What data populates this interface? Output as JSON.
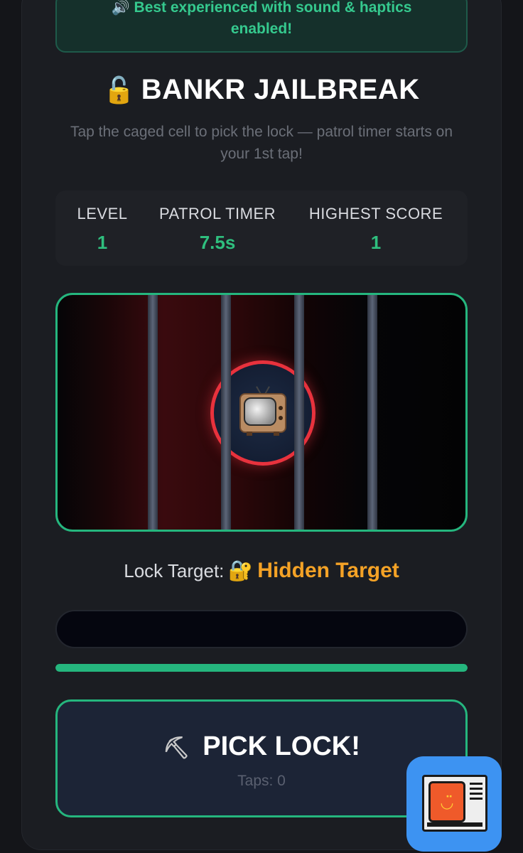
{
  "banner": {
    "icon": "speaker-icon",
    "text": "🔊 Best experienced with sound & haptics enabled!"
  },
  "title": {
    "icon": "🔓",
    "text": "BANKR JAILBREAK"
  },
  "subtitle": "Tap the caged cell to pick the lock — patrol timer starts on your 1st tap!",
  "stats": {
    "level_label": "LEVEL",
    "level_value": "1",
    "timer_label": "PATROL TIMER",
    "timer_value": "7.5s",
    "score_label": "HIGHEST SCORE",
    "score_value": "1"
  },
  "cell": {
    "target_icon": "television-icon",
    "bar_count": 4
  },
  "lock_target": {
    "label": "Lock Target:",
    "icon": "🔐",
    "value": "Hidden Target"
  },
  "lock_progress": 0,
  "patrol_timer_fraction": 1.0,
  "pick_button": {
    "icon": "⛏",
    "label": "PICK LOCK!",
    "taps": "Taps: 0"
  },
  "colors": {
    "accent": "#25b67e",
    "target_ring": "#e8323d",
    "hidden_target": "#f4a226",
    "app_badge": "#3d93f2"
  }
}
